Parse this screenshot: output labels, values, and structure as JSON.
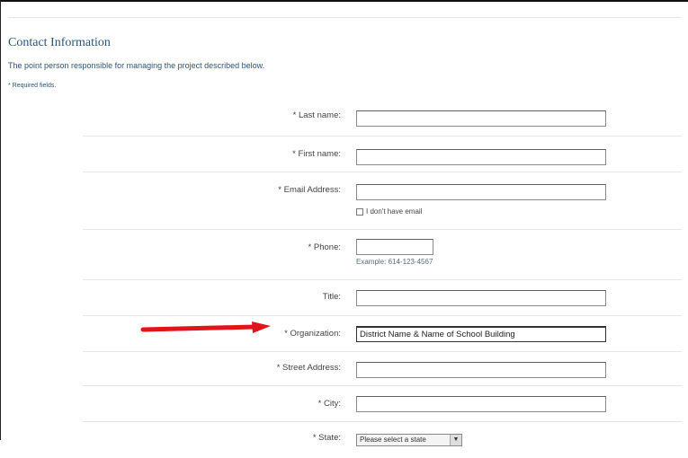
{
  "section": {
    "title": "Contact Information",
    "description": "The point person responsible for managing the project described below.",
    "required_note": "* Required fields."
  },
  "fields": {
    "last_name": {
      "label": "* Last name:",
      "value": ""
    },
    "first_name": {
      "label": "* First name:",
      "value": ""
    },
    "email": {
      "label": "* Email Address:",
      "value": "",
      "no_email_label": "I don't have email",
      "no_email_checked": false
    },
    "phone": {
      "label": "* Phone:",
      "value": "",
      "example": "Example: 614-123-4567"
    },
    "title": {
      "label": "Title:",
      "value": ""
    },
    "organization": {
      "label": "* Organization:",
      "value": "District Name & Name of School Building"
    },
    "street": {
      "label": "* Street Address:",
      "value": ""
    },
    "city": {
      "label": "* City:",
      "value": ""
    },
    "state": {
      "label": "* State:",
      "selected": "Please select a state"
    }
  },
  "annotation": {
    "arrow_color": "#e0141b"
  }
}
